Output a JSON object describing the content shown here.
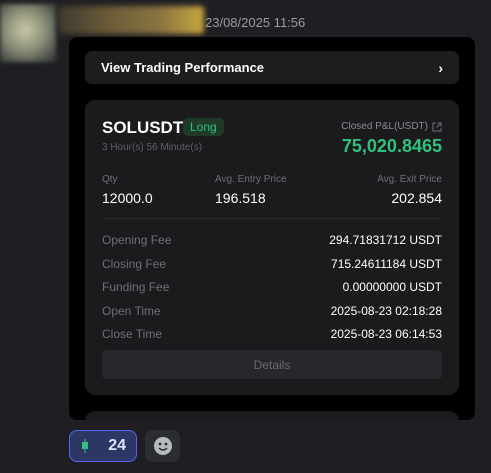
{
  "message": {
    "username": "",
    "timestamp": "23/08/2025 11:56"
  },
  "card": {
    "view_button_label": "View Trading Performance",
    "symbol": "SOLUSDT",
    "side": "Long",
    "duration": "3 Hour(s) 56 Minute(s)",
    "pnl_label": "Closed P&L(USDT)",
    "pnl_value": "75,020.8465",
    "qty_label": "Qty",
    "qty_value": "12000.0",
    "entry_label": "Avg. Entry Price",
    "entry_value": "196.518",
    "exit_label": "Avg. Exit Price",
    "exit_value": "202.854",
    "rows": [
      {
        "label": "Opening Fee",
        "value": "294.71831712 USDT"
      },
      {
        "label": "Closing Fee",
        "value": "715.24611184 USDT"
      },
      {
        "label": "Funding Fee",
        "value": "0.00000000 USDT"
      },
      {
        "label": "Open Time",
        "value": "2025-08-23 02:18:28"
      },
      {
        "label": "Close Time",
        "value": "2025-08-23 06:14:53"
      }
    ],
    "details_label": "Details"
  },
  "reactions": {
    "count": "24",
    "emoji_icon": "green-candle-icon",
    "add_icon": "smiley-face-icon"
  },
  "colors": {
    "profit": "#2ec27e",
    "reaction_accent": "#5865f2"
  }
}
